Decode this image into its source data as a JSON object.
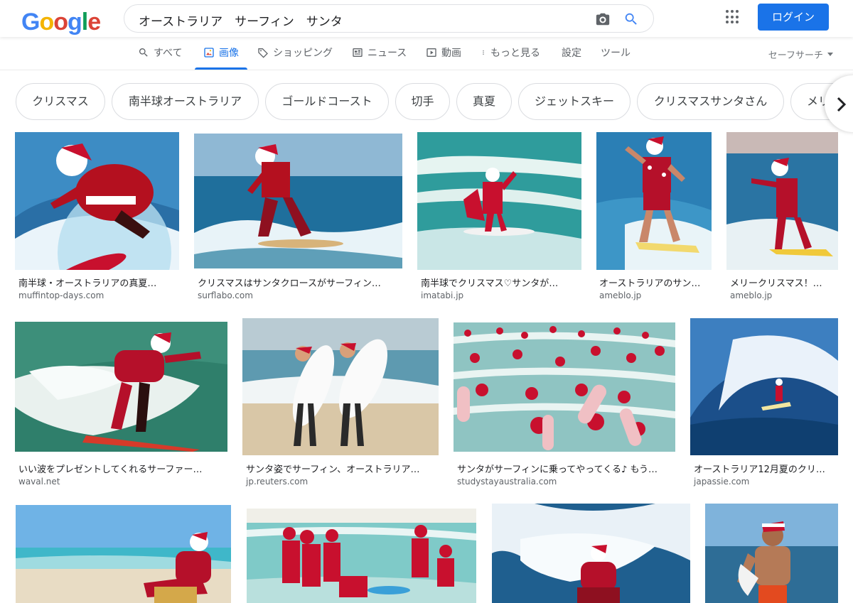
{
  "header": {
    "logo_letters": [
      "G",
      "o",
      "o",
      "g",
      "l",
      "e"
    ],
    "search_query": "オーストラリア　サーフィン　サンタ",
    "login_label": "ログイン"
  },
  "tabs": {
    "all": "すべて",
    "images": "画像",
    "shopping": "ショッピング",
    "news": "ニュース",
    "videos": "動画",
    "more": "もっと見る",
    "settings": "設定",
    "tools": "ツール",
    "safesearch": "セーフサーチ"
  },
  "chips": [
    "クリスマス",
    "南半球オーストラリア",
    "ゴールドコースト",
    "切手",
    "真夏",
    "ジェットスキー",
    "クリスマスサンタさん",
    "メリー"
  ],
  "results": [
    {
      "caption": "南半球・オーストラリアの真夏…",
      "domain": "muffintop-days.com"
    },
    {
      "caption": "クリスマスはサンタクロースがサーフィン…",
      "domain": "surflabo.com"
    },
    {
      "caption": "南半球でクリスマス♡サンタが…",
      "domain": "imatabi.jp"
    },
    {
      "caption": "オーストラリアのサン…",
      "domain": "ameblo.jp"
    },
    {
      "caption": "メリークリスマス！…",
      "domain": "ameblo.jp"
    },
    {
      "caption": "いい波をプレゼントしてくれるサーファー…",
      "domain": "waval.net"
    },
    {
      "caption": "サンタ姿でサーフィン、オーストラリア…",
      "domain": "jp.reuters.com"
    },
    {
      "caption": "サンタがサーフィンに乗ってやってくる♪ もう…",
      "domain": "studystayaustralia.com"
    },
    {
      "caption": "オーストラリア12月夏のクリ…",
      "domain": "japassie.com"
    },
    {
      "caption": "",
      "domain": ""
    },
    {
      "caption": "",
      "domain": ""
    },
    {
      "caption": "",
      "domain": ""
    },
    {
      "caption": "",
      "domain": ""
    }
  ],
  "colors": {
    "accent": "#1a73e8",
    "santa_red": "#c8102e",
    "ocean": "#2a7fb0"
  }
}
